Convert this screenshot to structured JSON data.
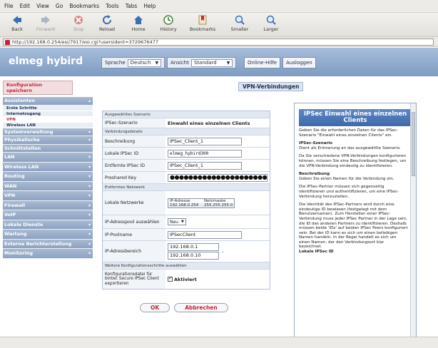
{
  "browser": {
    "menu": [
      "File",
      "Edit",
      "View",
      "Go",
      "Bookmarks",
      "Tools",
      "Tabs",
      "Help"
    ],
    "toolbar": {
      "back": "Back",
      "forward": "Forward",
      "stop": "Stop",
      "reload": "Reload",
      "home": "Home",
      "history": "History",
      "bookmarks": "Bookmarks",
      "smaller": "Smaller",
      "larger": "Larger"
    },
    "url": "http://192.168.0.254/esi/7917/esi.cgi?usersident=3729676477"
  },
  "header": {
    "brand": "elmeg hybird",
    "sprache_label": "Sprache",
    "sprache_value": "Deutsch",
    "ansicht_label": "Ansicht",
    "ansicht_value": "Standard",
    "online_hilfe": "Online-Hilfe",
    "ausloggen": "Ausloggen"
  },
  "sidebar": {
    "konfig": "Konfiguration speichern",
    "assistenten": "Assistenten",
    "sub_items": [
      "Erste Schritte",
      "Internetzugang",
      "VPN",
      "Wireless LAN"
    ],
    "items": [
      "Systemverwaltung",
      "Physikalische",
      "Schnittstellen",
      "LAN",
      "Wireless LAN",
      "Routing",
      "WAN",
      "VPN",
      "Firewall",
      "VoIP",
      "Lokale Dienste",
      "Wartung",
      "Externe Berichterstellung",
      "Monitoring"
    ]
  },
  "main": {
    "title": "VPN-Verbindungen",
    "sect_scenario": "Ausgewähltes Szenario",
    "ipsec_szenario_label": "IPSec-Szenario",
    "ipsec_szenario_value": "Einwahl eines einzelnen Clients",
    "sect_details": "Verbindungsdetails",
    "beschreibung_label": "Beschreibung",
    "beschreibung_value": "IPSec_Client_1",
    "lokale_id_label": "Lokale IPSec ID",
    "lokale_id_value": "elmeg_hybird300",
    "entfernte_id_label": "Entfernte IPSec ID",
    "entfernte_id_value": "IPSec_Client_1",
    "preshared_label": "Preshared Key",
    "preshared_value": "●●●●●●●●●●●●●●●●●●●●●●",
    "sect_netzwerk": "Entferntes Netzwerk",
    "lokale_netzwerke_label": "Lokale Netzwerke",
    "ip_hdr_addr": "IP-Adresse",
    "ip_hdr_mask": "Netzmaske",
    "ip_addr": "192.168.0.254",
    "ip_mask": "255.255.255.0",
    "ip_pool_label": "IP-Adresspool auswählen",
    "ip_pool_value": "Neu",
    "ip_poolname_label": "IP-Poolname",
    "ip_poolname_value": "IPSecClient",
    "ip_bereich_label": "IP-Adressbereich",
    "ip_bereich_from": "192.168.0.1",
    "ip_bereich_dash": "-",
    "ip_bereich_to": "192.168.0.10",
    "sect_weitere": "Weitere Konfigurationsschritte auswählen",
    "export_label": "Konfigurationsdatei für bintec Secure IPSec Client exportieren",
    "export_value": "Aktiviert",
    "ok": "OK",
    "abbrechen": "Abbrechen"
  },
  "help": {
    "title": "IPSec Einwahl eines einzelnen Clients",
    "p1": "Geben Sie die erforderlichen Daten für das IPSec-Szenario \"Einwahl eines einzelnen Clients\" ein.",
    "h1": "IPSec-Szenario",
    "p2": "Dient als Erinnerung an das ausgewählte Szenario.",
    "p3": "Da Sie verschiedene VPN-Verbindungen konfigurieren können, müssen Sie eine Beschreibung festlegen, um die VPN-Verbindung eindeutig zu identifizieren.",
    "h2": "Beschreibung",
    "p4": "Geben Sie einen Namen für die Verbindung ein.",
    "p5": "Die IPSec-Partner müssen sich gegenseitig identifizieren und authentifizieren, um eine IPSec-Verbindung herzustellen.",
    "p6": "Die Identität des IPSec-Partners wird durch eine eindeutige ID bewiesen (festgelegt mit dem Benutzernamen). Zum Herstellen einer IPSec-Verbindung muss jeder IPSec Partner in der Lage sein, die ID des anderen Partners zu identifizieren. Deshalb müssen beide 'IDs' auf beiden IPSec Peers konfiguriert sein. Bei der ID kann es sich um einen beliebigen Namen handeln. In der Regel handelt es sich um einen Namen, der den Verbindungsort klar bezeichnet.",
    "h3": "Lokale IPSec ID"
  }
}
